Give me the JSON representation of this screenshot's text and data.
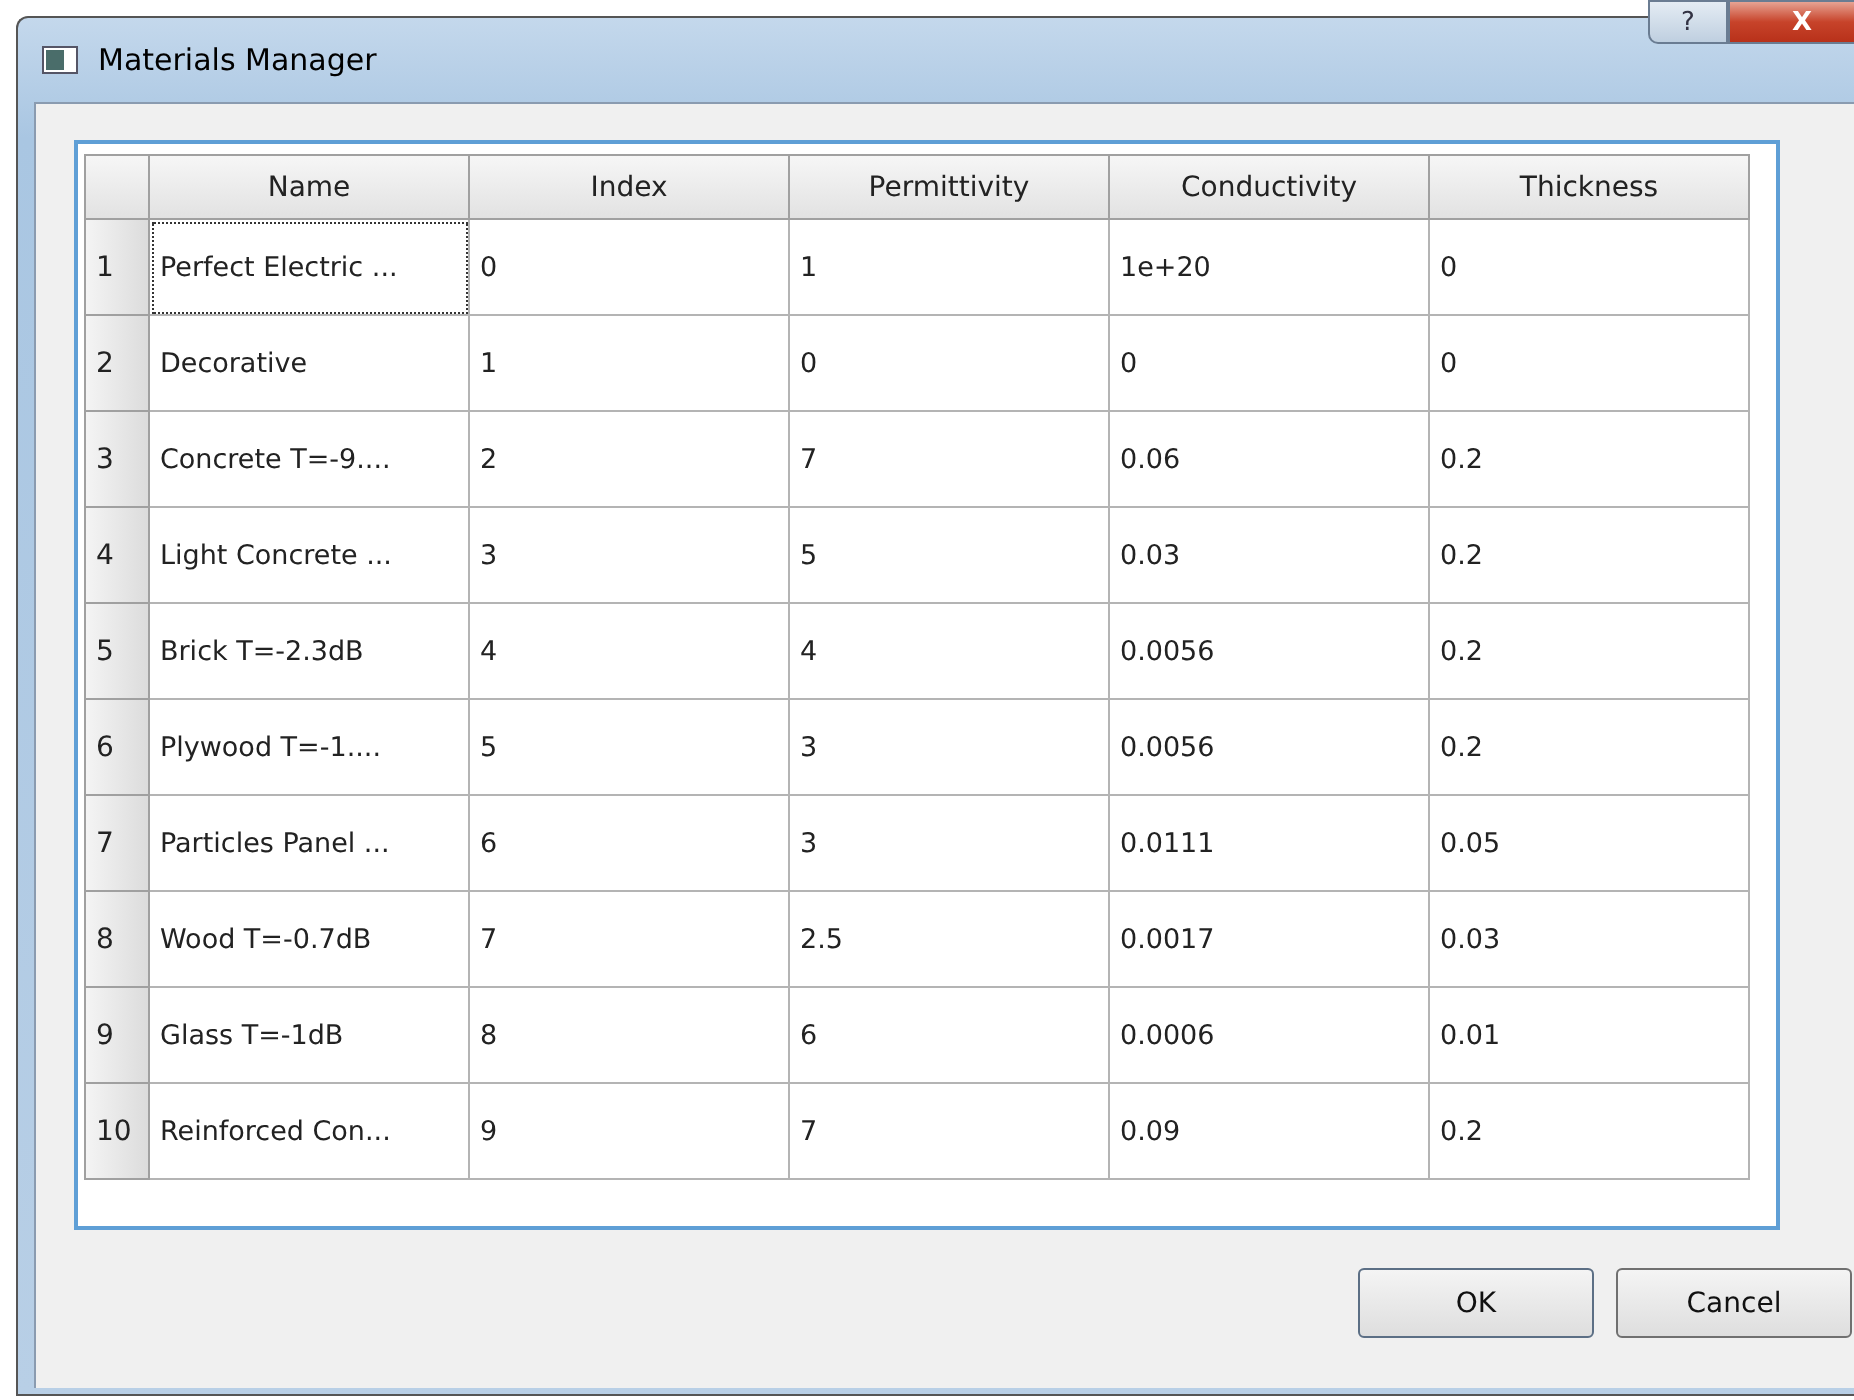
{
  "window": {
    "title": "Materials Manager",
    "help_button": "?",
    "close_button": "X"
  },
  "table": {
    "columns": [
      "Name",
      "Index",
      "Permittivity",
      "Conductivity",
      "Thickness"
    ],
    "rows": [
      {
        "number": "1",
        "cells": [
          "Perfect Electric ...",
          "0",
          "1",
          "1e+20",
          "0"
        ],
        "focused": true
      },
      {
        "number": "2",
        "cells": [
          "Decorative",
          "1",
          "0",
          "0",
          "0"
        ],
        "focused": false
      },
      {
        "number": "3",
        "cells": [
          "Concrete T=-9....",
          "2",
          "7",
          "0.06",
          "0.2"
        ],
        "focused": false
      },
      {
        "number": "4",
        "cells": [
          "Light Concrete ...",
          "3",
          "5",
          "0.03",
          "0.2"
        ],
        "focused": false
      },
      {
        "number": "5",
        "cells": [
          "Brick T=-2.3dB",
          "4",
          "4",
          "0.0056",
          "0.2"
        ],
        "focused": false
      },
      {
        "number": "6",
        "cells": [
          "Plywood T=-1....",
          "5",
          "3",
          "0.0056",
          "0.2"
        ],
        "focused": false
      },
      {
        "number": "7",
        "cells": [
          "Particles Panel ...",
          "6",
          "3",
          "0.0111",
          "0.05"
        ],
        "focused": false
      },
      {
        "number": "8",
        "cells": [
          "Wood T=-0.7dB",
          "7",
          "2.5",
          "0.0017",
          "0.03"
        ],
        "focused": false
      },
      {
        "number": "9",
        "cells": [
          "Glass T=-1dB",
          "8",
          "6",
          "0.0006",
          "0.01"
        ],
        "focused": false
      },
      {
        "number": "10",
        "cells": [
          "Reinforced Con...",
          "9",
          "7",
          "0.09",
          "0.2"
        ],
        "focused": false
      }
    ]
  },
  "buttons": [
    "OK",
    "Cancel"
  ]
}
